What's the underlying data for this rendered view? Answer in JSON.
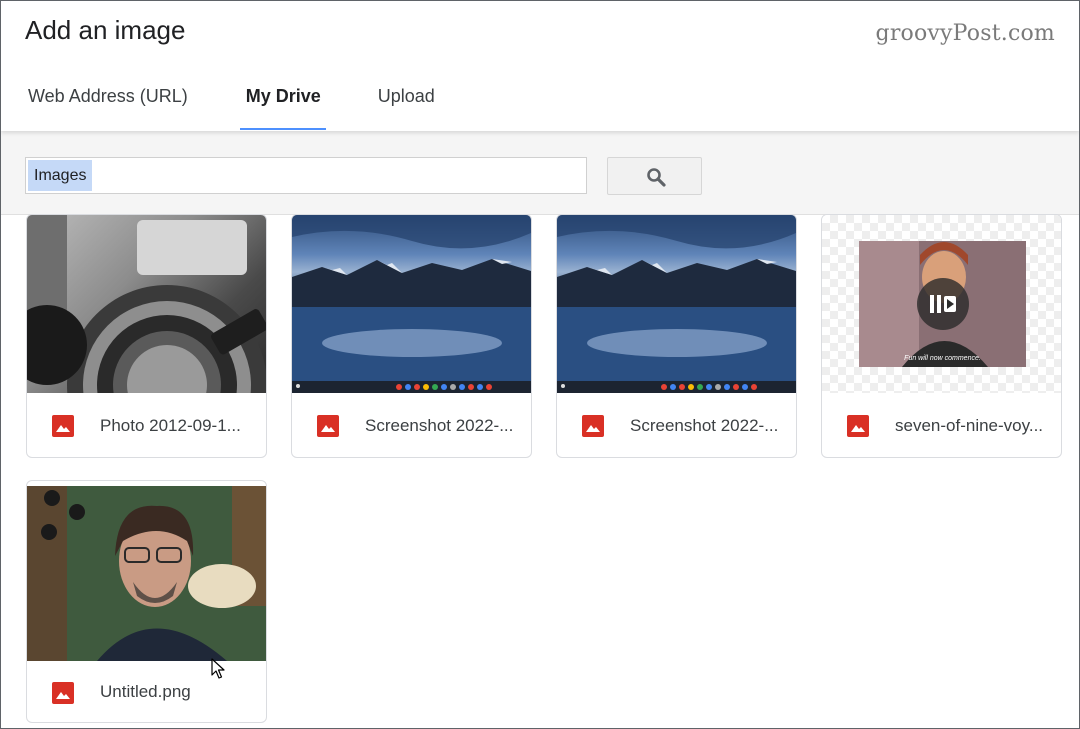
{
  "dialog": {
    "title": "Add an image",
    "watermark": "groovyPost.com"
  },
  "tabs": [
    {
      "label": "Web Address (URL)",
      "active": false
    },
    {
      "label": "My Drive",
      "active": true
    },
    {
      "label": "Upload",
      "active": false
    }
  ],
  "search": {
    "value": "Images",
    "button_icon": "search-icon"
  },
  "files": [
    {
      "name": "Photo 2012-09-1...",
      "type_icon": "image-file-icon",
      "thumbnail": "headphones"
    },
    {
      "name": "Screenshot 2022-...",
      "type_icon": "image-file-icon",
      "thumbnail": "mountain-lake"
    },
    {
      "name": "Screenshot 2022-...",
      "type_icon": "image-file-icon",
      "thumbnail": "mountain-lake"
    },
    {
      "name": "seven-of-nine-voy...",
      "type_icon": "image-file-icon",
      "thumbnail": "gif-clip",
      "gif_caption": "Fun will now commence."
    },
    {
      "name": "Untitled.png",
      "type_icon": "image-file-icon",
      "thumbnail": "portrait"
    }
  ],
  "colors": {
    "accent": "#4d90fe",
    "file_icon_red": "#d93025",
    "selection": "#c5d9f7"
  }
}
